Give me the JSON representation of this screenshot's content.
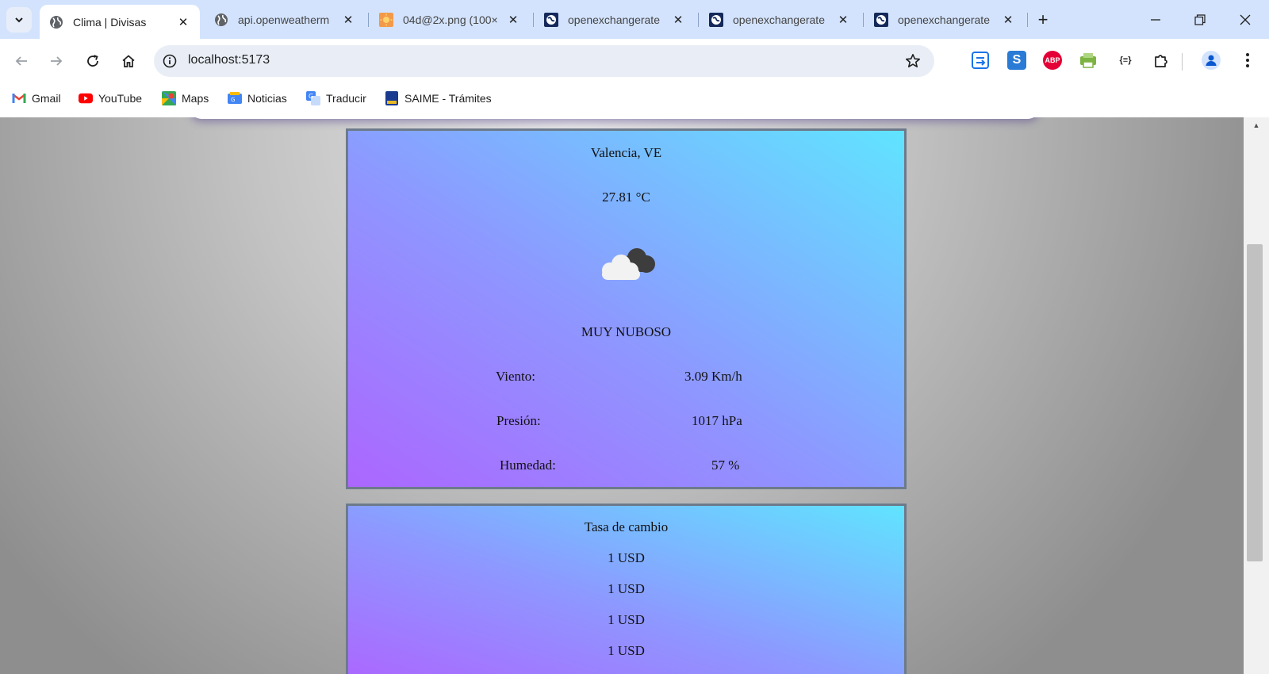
{
  "browser": {
    "tabs": [
      {
        "title": "Clima | Divisas",
        "icon": "globe-icon",
        "active": true
      },
      {
        "title": "api.openweatherm",
        "icon": "globe-icon",
        "active": false
      },
      {
        "title": "04d@2x.png (100×",
        "icon": "sun-image-icon",
        "active": false
      },
      {
        "title": "openexchangerate",
        "icon": "openexchangerates-icon",
        "active": false
      },
      {
        "title": "openexchangerate",
        "icon": "openexchangerates-icon",
        "active": false
      },
      {
        "title": "openexchangerate",
        "icon": "openexchangerates-icon",
        "active": false
      }
    ],
    "new_tab_symbol": "+",
    "url": "localhost:5173",
    "bookmarks": [
      {
        "label": "Gmail",
        "icon": "gmail-icon"
      },
      {
        "label": "YouTube",
        "icon": "youtube-icon"
      },
      {
        "label": "Maps",
        "icon": "maps-icon"
      },
      {
        "label": "Noticias",
        "icon": "news-icon"
      },
      {
        "label": "Traducir",
        "icon": "translate-icon"
      },
      {
        "label": "SAIME - Trámites",
        "icon": "saime-icon"
      }
    ],
    "extensions": [
      {
        "name": "extension-1",
        "text": ""
      },
      {
        "name": "extension-s",
        "text": "S"
      },
      {
        "name": "adblock-plus",
        "text": "ABP"
      },
      {
        "name": "extension-print",
        "text": ""
      },
      {
        "name": "json-formatter",
        "text": "{≡}"
      }
    ]
  },
  "weather": {
    "city": "Valencia, VE",
    "temperature": "27.81 °C",
    "condition_icon": "cloud-icon",
    "description": "MUY NUBOSO",
    "rows": [
      {
        "label": "Viento:",
        "value": "3.09 Km/h"
      },
      {
        "label": "Presión:",
        "value": "1017 hPa"
      },
      {
        "label": "Humedad:",
        "value": "57 %"
      }
    ]
  },
  "rates": {
    "title": "Tasa de cambio",
    "items": [
      "1 USD",
      "1 USD",
      "1 USD",
      "1 USD"
    ]
  },
  "colors": {
    "card_gradient_start": "#ac66ff",
    "card_gradient_end": "#60e4ff",
    "card_border": "#6d7a8b",
    "tabstrip": "#d3e3fd"
  }
}
